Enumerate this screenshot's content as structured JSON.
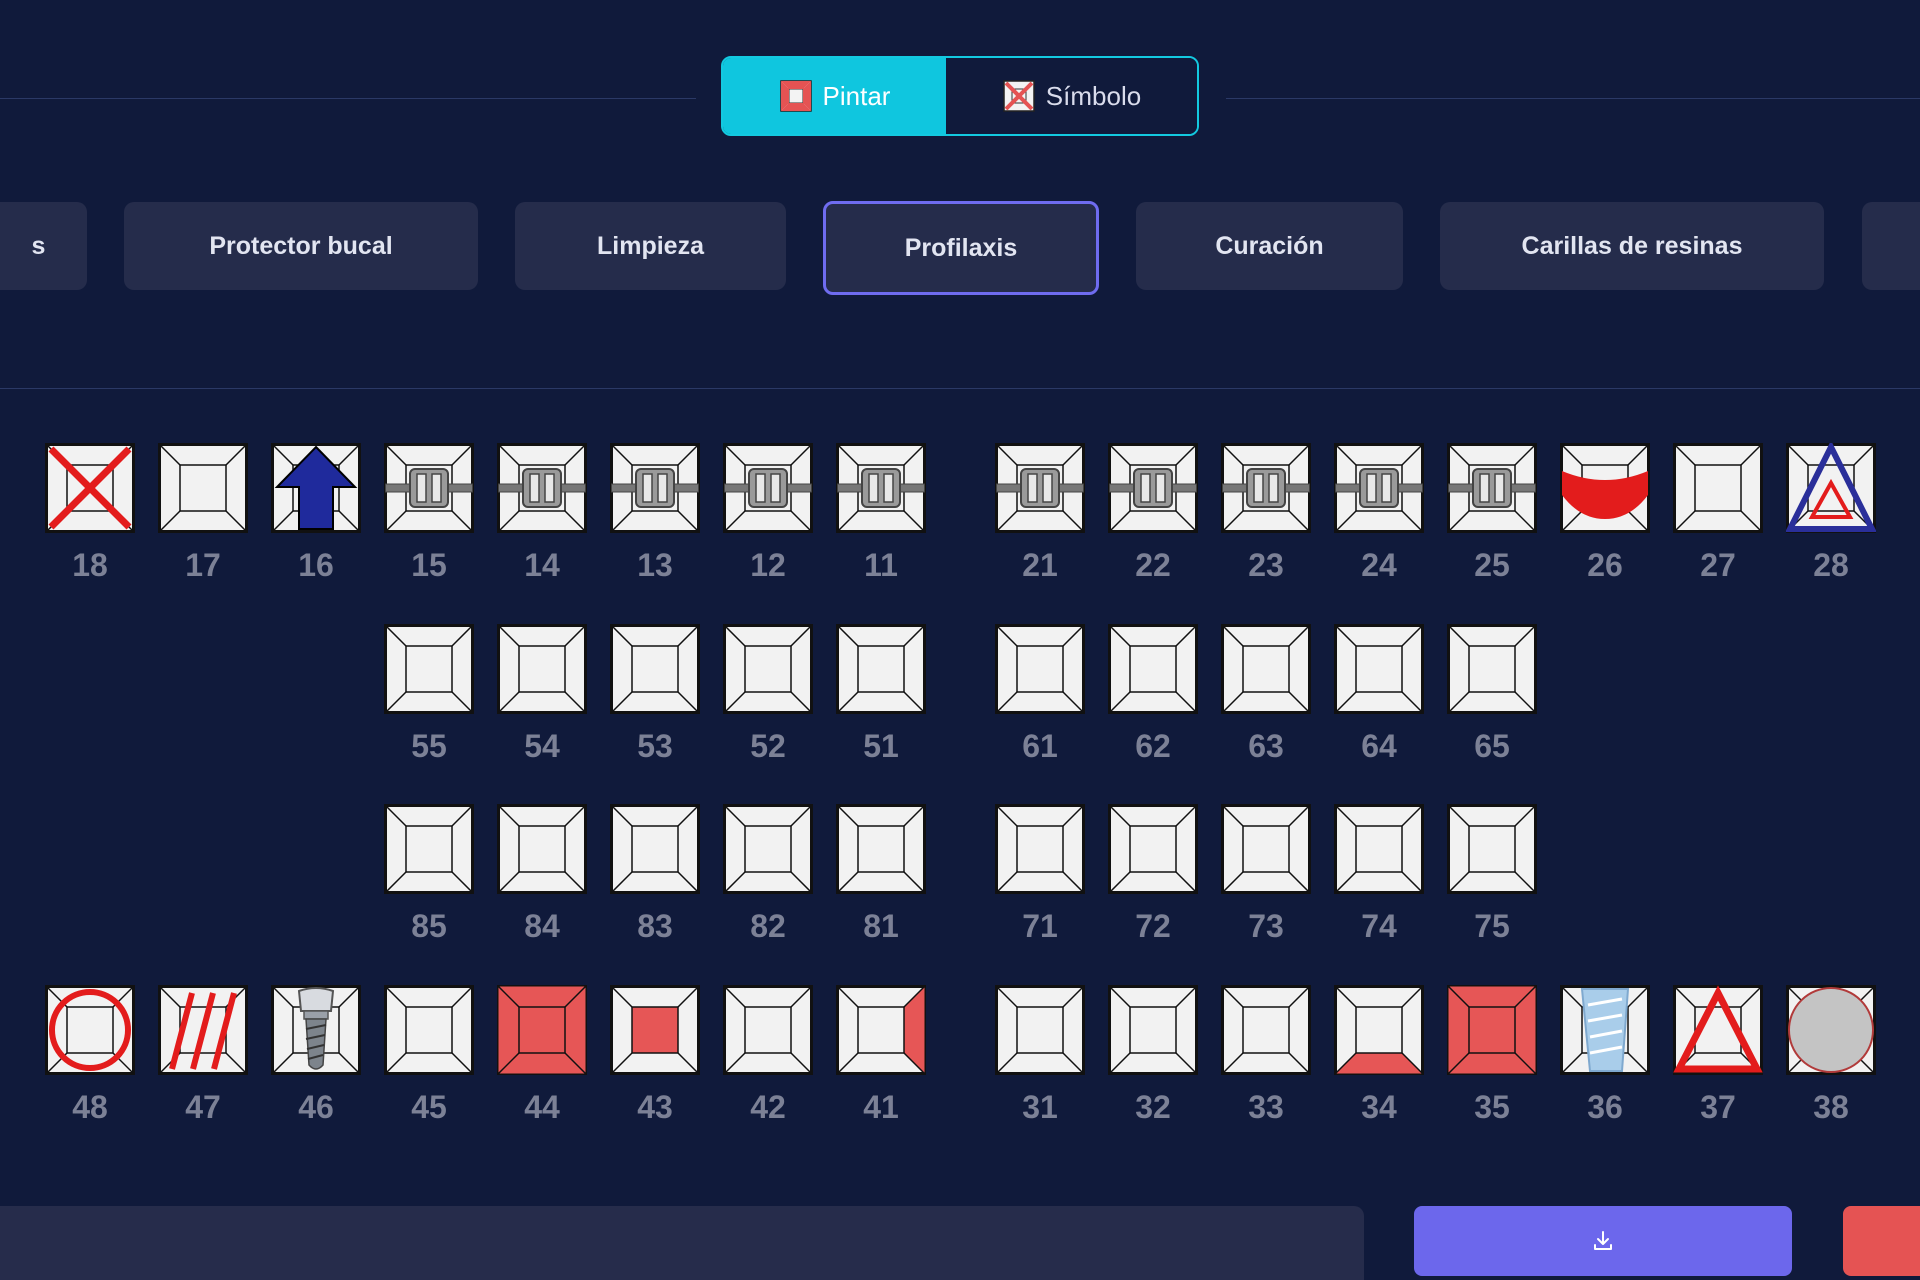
{
  "mode_toggle": {
    "paint_label": "Pintar",
    "symbol_label": "Símbolo",
    "active": "paint",
    "paint_icon": "tooth-paint-icon",
    "symbol_icon": "tooth-cross-icon"
  },
  "treatments": [
    {
      "label": "s",
      "selected": false
    },
    {
      "label": "Protector bucal",
      "selected": false
    },
    {
      "label": "Limpieza",
      "selected": false
    },
    {
      "label": "Profilaxis",
      "selected": true
    },
    {
      "label": "Curación",
      "selected": false
    },
    {
      "label": "Carillas de resinas",
      "selected": false
    },
    {
      "label": "",
      "selected": false
    }
  ],
  "odontogram": {
    "rows": [
      {
        "name": "upper-permanent",
        "teeth": [
          {
            "n": "18",
            "mark": "extraction-x"
          },
          {
            "n": "17",
            "mark": "none"
          },
          {
            "n": "16",
            "mark": "blue-arrow"
          },
          {
            "n": "15",
            "mark": "bracket"
          },
          {
            "n": "14",
            "mark": "bracket"
          },
          {
            "n": "13",
            "mark": "bracket"
          },
          {
            "n": "12",
            "mark": "bracket"
          },
          {
            "n": "11",
            "mark": "bracket"
          },
          {
            "n": "21",
            "mark": "bracket"
          },
          {
            "n": "22",
            "mark": "bracket"
          },
          {
            "n": "23",
            "mark": "bracket"
          },
          {
            "n": "24",
            "mark": "bracket"
          },
          {
            "n": "25",
            "mark": "bracket"
          },
          {
            "n": "26",
            "mark": "red-band"
          },
          {
            "n": "27",
            "mark": "none"
          },
          {
            "n": "28",
            "mark": "blue-red-triangle"
          }
        ]
      },
      {
        "name": "upper-primary",
        "teeth": [
          {
            "n": "55",
            "mark": "none"
          },
          {
            "n": "54",
            "mark": "none"
          },
          {
            "n": "53",
            "mark": "none"
          },
          {
            "n": "52",
            "mark": "none"
          },
          {
            "n": "51",
            "mark": "none"
          },
          {
            "n": "61",
            "mark": "none"
          },
          {
            "n": "62",
            "mark": "none"
          },
          {
            "n": "63",
            "mark": "none"
          },
          {
            "n": "64",
            "mark": "none"
          },
          {
            "n": "65",
            "mark": "none"
          }
        ]
      },
      {
        "name": "lower-primary",
        "teeth": [
          {
            "n": "85",
            "mark": "none"
          },
          {
            "n": "84",
            "mark": "none"
          },
          {
            "n": "83",
            "mark": "none"
          },
          {
            "n": "82",
            "mark": "none"
          },
          {
            "n": "81",
            "mark": "none"
          },
          {
            "n": "71",
            "mark": "none"
          },
          {
            "n": "72",
            "mark": "none"
          },
          {
            "n": "73",
            "mark": "none"
          },
          {
            "n": "74",
            "mark": "none"
          },
          {
            "n": "75",
            "mark": "none"
          }
        ]
      },
      {
        "name": "lower-permanent",
        "teeth": [
          {
            "n": "48",
            "mark": "red-circle"
          },
          {
            "n": "47",
            "mark": "red-slashes"
          },
          {
            "n": "46",
            "mark": "implant"
          },
          {
            "n": "45",
            "mark": "none"
          },
          {
            "n": "44",
            "mark": "red-all"
          },
          {
            "n": "43",
            "mark": "red-center"
          },
          {
            "n": "42",
            "mark": "none"
          },
          {
            "n": "41",
            "mark": "red-right"
          },
          {
            "n": "31",
            "mark": "none"
          },
          {
            "n": "32",
            "mark": "none"
          },
          {
            "n": "33",
            "mark": "none"
          },
          {
            "n": "34",
            "mark": "red-bottom"
          },
          {
            "n": "35",
            "mark": "red-all"
          },
          {
            "n": "36",
            "mark": "blue-crown"
          },
          {
            "n": "37",
            "mark": "red-triangle"
          },
          {
            "n": "38",
            "mark": "grey-circle"
          }
        ]
      }
    ]
  },
  "actions": {
    "download_icon": "download-icon"
  },
  "colors": {
    "accent": "#0fc6df",
    "primary": "#6c67ec",
    "danger": "#e55353",
    "mark_red": "#e31c1c",
    "fill_red": "#e65656",
    "arrow_blue": "#1f2a9c",
    "background": "#101a3b"
  }
}
